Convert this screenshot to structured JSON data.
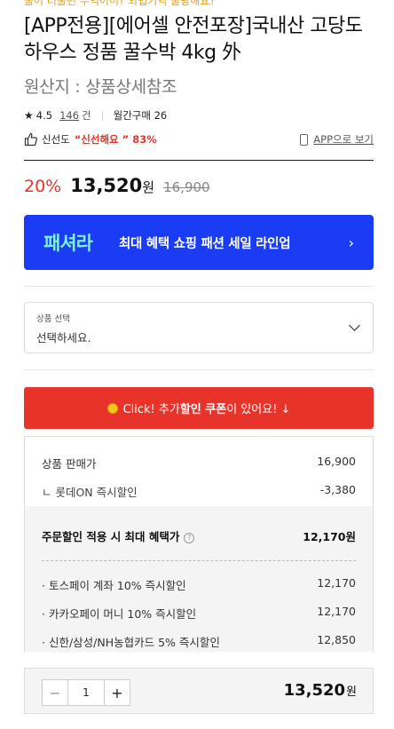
{
  "header": {
    "cut_text": "물어 더울던 무역어이? 외법기역 물량해요?",
    "title": "[APP전용][에어셀 안전포장]국내산 고당도 하우스 정품 꿀수박 4kg 外",
    "origin": "원산지 : 상품상세참조"
  },
  "rating": {
    "score": "4.5",
    "review_count": "146",
    "review_unit": "건",
    "monthly_label": "월간구매 26"
  },
  "freshness": {
    "label": "신선도",
    "value": "“신선해요 ” 83%",
    "app_link": "APP으로 보기"
  },
  "price": {
    "discount": "20%",
    "sale_price": "13,520",
    "won": "원",
    "original_price": "16,900"
  },
  "banner": {
    "logo": "패셔라",
    "text": "최대 혜택 쇼핑 패션 세일 라인업",
    "arrow": "›",
    "bg_color": "#1a3cf5"
  },
  "option": {
    "label": "상품 선택",
    "value": "선택하세요."
  },
  "coupon": {
    "prefix": "Click! 추가 ",
    "highlight": "할인 쿠폰",
    "suffix": "이 있어요! ↓",
    "bg_color": "#e8332b"
  },
  "benefits": {
    "seller_label": "상품 판매가",
    "seller_value": "16,900",
    "lotte_label": "ㄴ 롯데ON 즉시할인",
    "lotte_value": "-3,380",
    "max_label": "주문할인 적용 시 최대 혜택가",
    "max_help": "?",
    "max_value": "12,170원",
    "cards": [
      {
        "label": "· 토스페이 계좌 10% 즉시할인",
        "value": "12,170"
      },
      {
        "label": "· 카카오페이 머니 10% 즉시할인",
        "value": "12,170"
      },
      {
        "label": "· 신한/삼성/NH농협카드 5% 즉시할인",
        "value": "12,850"
      }
    ]
  },
  "quantity": {
    "minus": "−",
    "value": "1",
    "plus": "+",
    "total_price": "13,520",
    "total_won": "원"
  }
}
